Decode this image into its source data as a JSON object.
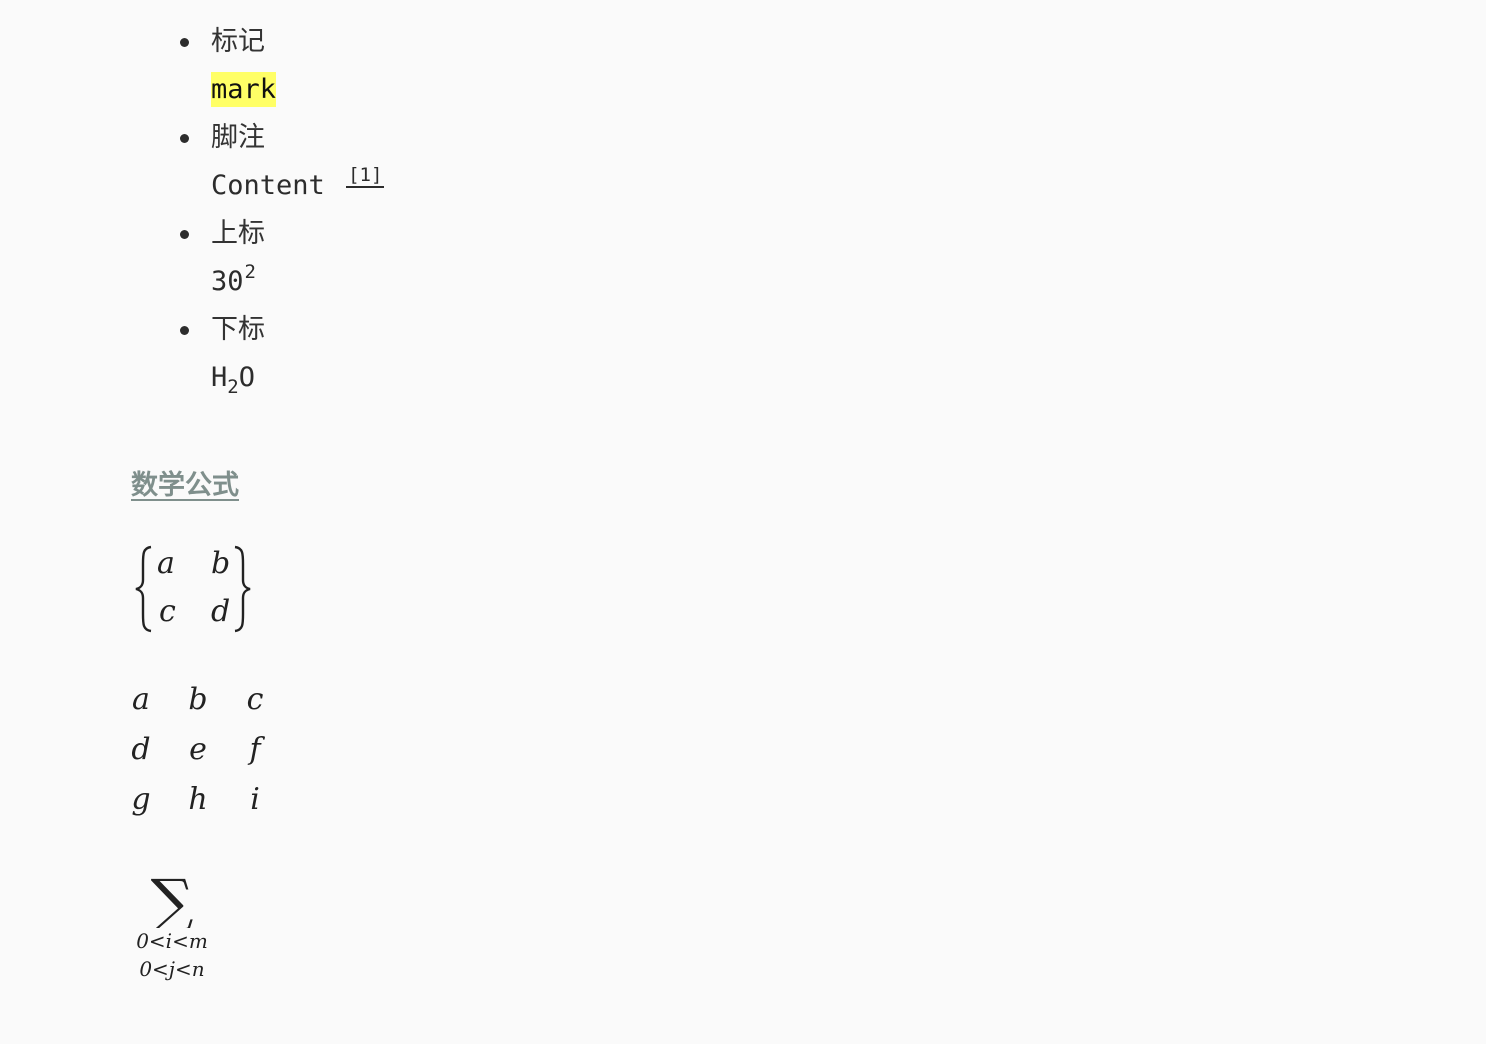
{
  "list": {
    "items": [
      {
        "title": "标记",
        "content": "mark"
      },
      {
        "title": "脚注",
        "content": "Content",
        "footnote_ref": "[1]"
      },
      {
        "title": "上标",
        "content_base": "30",
        "content_sup": "2"
      },
      {
        "title": "下标",
        "content_pre": "H",
        "content_sub": "2",
        "content_post": "O"
      }
    ]
  },
  "math_section": {
    "heading": "数学公式",
    "brace_matrix": {
      "cells": [
        "a",
        "b",
        "c",
        "d"
      ]
    },
    "plain_matrix": {
      "cells": [
        "a",
        "b",
        "c",
        "d",
        "e",
        "f",
        "g",
        "h",
        "i"
      ]
    },
    "summation": {
      "symbol": "∑",
      "subscript_line1": "0<i<m",
      "subscript_line2": "0<j<n"
    }
  }
}
